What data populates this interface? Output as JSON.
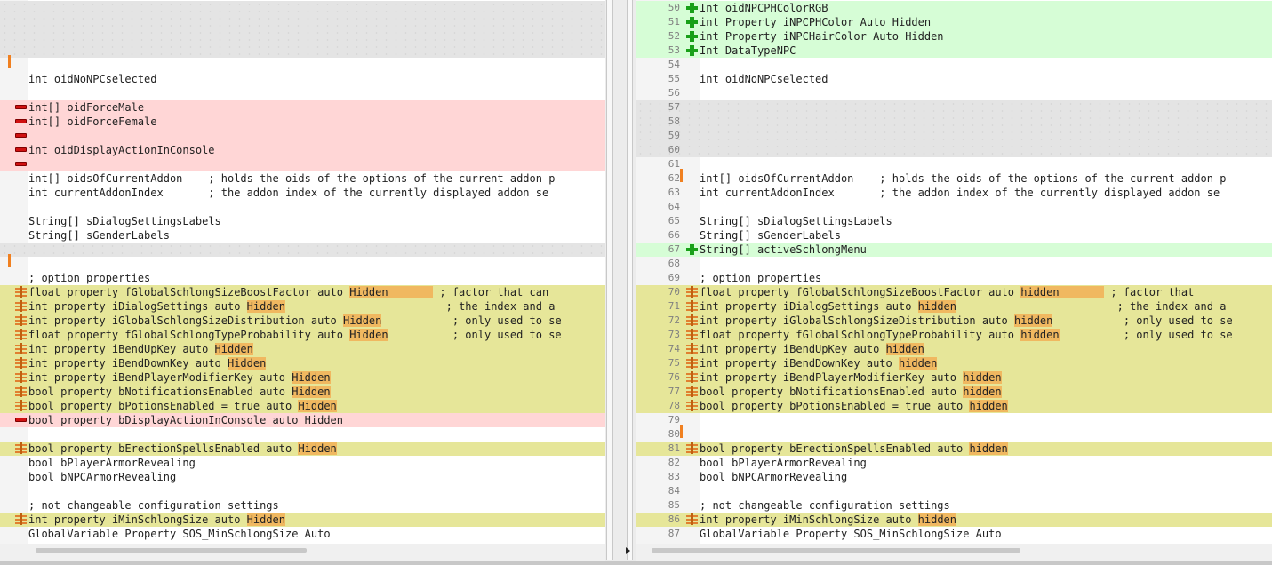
{
  "left_pane": {
    "lines": [
      {
        "type": "empty",
        "text": ""
      },
      {
        "type": "empty",
        "text": ""
      },
      {
        "type": "empty",
        "text": ""
      },
      {
        "type": "empty",
        "text": ""
      },
      {
        "type": "blank",
        "text": "",
        "bar": true
      },
      {
        "type": "same",
        "text": "int oidNoNPCselected"
      },
      {
        "type": "blank",
        "text": ""
      },
      {
        "type": "del",
        "text": "int[] oidForceMale"
      },
      {
        "type": "del",
        "text": "int[] oidForceFemale"
      },
      {
        "type": "del",
        "text": ""
      },
      {
        "type": "del",
        "text": "int oidDisplayActionInConsole"
      },
      {
        "type": "del",
        "text": ""
      },
      {
        "type": "same",
        "text": "int[] oidsOfCurrentAddon    ; holds the oids of the options of the current addon p"
      },
      {
        "type": "same",
        "text": "int currentAddonIndex       ; the addon index of the currently displayed addon se"
      },
      {
        "type": "blank",
        "text": ""
      },
      {
        "type": "same",
        "text": "String[] sDialogSettingsLabels"
      },
      {
        "type": "same",
        "text": "String[] sGenderLabels"
      },
      {
        "type": "empty",
        "text": ""
      },
      {
        "type": "blank",
        "text": "",
        "bar": true
      },
      {
        "type": "same",
        "text": "; option properties"
      },
      {
        "type": "chg",
        "segments": [
          "float property fGlobalSchlongSizeBoostFactor auto ",
          "Hidden       ",
          " ; factor that can"
        ]
      },
      {
        "type": "chg",
        "segments": [
          "int property iDialogSettings auto ",
          "Hidden",
          "                         ; the index and a"
        ]
      },
      {
        "type": "chg",
        "segments": [
          "int property iGlobalSchlongSizeDistribution auto ",
          "Hidden",
          "           ; only used to se"
        ]
      },
      {
        "type": "chg",
        "segments": [
          "float property fGlobalSchlongTypeProbability auto ",
          "Hidden",
          "          ; only used to se"
        ]
      },
      {
        "type": "chg",
        "segments": [
          "int property iBendUpKey auto ",
          "Hidden",
          ""
        ]
      },
      {
        "type": "chg",
        "segments": [
          "int property iBendDownKey auto ",
          "Hidden",
          ""
        ]
      },
      {
        "type": "chg",
        "segments": [
          "int property iBendPlayerModifierKey auto ",
          "Hidden",
          ""
        ]
      },
      {
        "type": "chg",
        "segments": [
          "bool property bNotificationsEnabled auto ",
          "Hidden",
          ""
        ]
      },
      {
        "type": "chg",
        "segments": [
          "bool property bPotionsEnabled = true auto ",
          "Hidden",
          ""
        ]
      },
      {
        "type": "del",
        "text": "bool property bDisplayActionInConsole auto Hidden"
      },
      {
        "type": "blank",
        "text": ""
      },
      {
        "type": "chg",
        "segments": [
          "bool property bErectionSpellsEnabled auto ",
          "Hidden",
          ""
        ]
      },
      {
        "type": "same",
        "text": "bool bPlayerArmorRevealing"
      },
      {
        "type": "same",
        "text": "bool bNPCArmorRevealing"
      },
      {
        "type": "blank",
        "text": ""
      },
      {
        "type": "same",
        "text": "; not changeable configuration settings"
      },
      {
        "type": "chg",
        "segments": [
          "int property iMinSchlongSize auto ",
          "Hidden",
          ""
        ]
      },
      {
        "type": "same",
        "text": "GlobalVariable Property SOS_MinSchlongSize Auto"
      }
    ]
  },
  "right_pane": {
    "lines": [
      {
        "num": "50",
        "type": "add",
        "text": "Int oidNPCPHColorRGB"
      },
      {
        "num": "51",
        "type": "add",
        "text": "int Property iNPCPHColor Auto Hidden"
      },
      {
        "num": "52",
        "type": "add",
        "text": "int Property iNPCHairColor Auto Hidden"
      },
      {
        "num": "53",
        "type": "add",
        "text": "Int DataTypeNPC"
      },
      {
        "num": "54",
        "type": "blank",
        "text": ""
      },
      {
        "num": "55",
        "type": "same",
        "text": "int oidNoNPCselected"
      },
      {
        "num": "56",
        "type": "blank",
        "text": ""
      },
      {
        "num": "57",
        "type": "empty",
        "text": ""
      },
      {
        "num": "58",
        "type": "empty",
        "text": ""
      },
      {
        "num": "59",
        "type": "empty",
        "text": ""
      },
      {
        "num": "60",
        "type": "empty",
        "text": ""
      },
      {
        "num": "61",
        "type": "blank",
        "text": ""
      },
      {
        "num": "62",
        "type": "same",
        "text": "int[] oidsOfCurrentAddon    ; holds the oids of the options of the current addon p",
        "bar": true
      },
      {
        "num": "63",
        "type": "same",
        "text": "int currentAddonIndex       ; the addon index of the currently displayed addon se"
      },
      {
        "num": "64",
        "type": "blank",
        "text": ""
      },
      {
        "num": "65",
        "type": "same",
        "text": "String[] sDialogSettingsLabels"
      },
      {
        "num": "66",
        "type": "same",
        "text": "String[] sGenderLabels"
      },
      {
        "num": "67",
        "type": "add",
        "text": "String[] activeSchlongMenu"
      },
      {
        "num": "68",
        "type": "blank",
        "text": ""
      },
      {
        "num": "69",
        "type": "same",
        "text": "; option properties"
      },
      {
        "num": "70",
        "type": "chg",
        "segments": [
          "float property fGlobalSchlongSizeBoostFactor auto ",
          "hidden       ",
          " ; factor that"
        ]
      },
      {
        "num": "71",
        "type": "chg",
        "segments": [
          "int property iDialogSettings auto ",
          "hidden",
          "                         ; the index and a"
        ]
      },
      {
        "num": "72",
        "type": "chg",
        "segments": [
          "int property iGlobalSchlongSizeDistribution auto ",
          "hidden",
          "           ; only used to se"
        ]
      },
      {
        "num": "73",
        "type": "chg",
        "segments": [
          "float property fGlobalSchlongTypeProbability auto ",
          "hidden",
          "          ; only used to se"
        ]
      },
      {
        "num": "74",
        "type": "chg",
        "segments": [
          "int property iBendUpKey auto ",
          "hidden",
          ""
        ]
      },
      {
        "num": "75",
        "type": "chg",
        "segments": [
          "int property iBendDownKey auto ",
          "hidden",
          ""
        ]
      },
      {
        "num": "76",
        "type": "chg",
        "segments": [
          "int property iBendPlayerModifierKey auto ",
          "hidden",
          ""
        ]
      },
      {
        "num": "77",
        "type": "chg",
        "segments": [
          "bool property bNotificationsEnabled auto ",
          "hidden",
          ""
        ]
      },
      {
        "num": "78",
        "type": "chg",
        "segments": [
          "bool property bPotionsEnabled = true auto ",
          "hidden",
          ""
        ]
      },
      {
        "num": "79",
        "type": "blank",
        "text": ""
      },
      {
        "num": "80",
        "type": "blank",
        "text": "",
        "bar": true
      },
      {
        "num": "81",
        "type": "chg",
        "segments": [
          "bool property bErectionSpellsEnabled auto ",
          "hidden",
          ""
        ]
      },
      {
        "num": "82",
        "type": "same",
        "text": "bool bPlayerArmorRevealing"
      },
      {
        "num": "83",
        "type": "same",
        "text": "bool bNPCArmorRevealing"
      },
      {
        "num": "84",
        "type": "blank",
        "text": ""
      },
      {
        "num": "85",
        "type": "same",
        "text": "; not changeable configuration settings"
      },
      {
        "num": "86",
        "type": "chg",
        "segments": [
          "int property iMinSchlongSize auto ",
          "hidden",
          ""
        ]
      },
      {
        "num": "87",
        "type": "same",
        "text": "GlobalVariable Property SOS_MinSchlongSize Auto"
      }
    ]
  },
  "colors": {
    "deleted_bg": "#ffd6d6",
    "added_bg": "#d6fdd6",
    "changed_bg": "#e6e699",
    "inline_highlight": "#f0b860",
    "empty_placeholder": "#e4e4e4",
    "change_bar": "#f08020"
  },
  "icons": {
    "deleted": "minus-icon",
    "added": "plus-icon",
    "changed": "change-icon"
  }
}
